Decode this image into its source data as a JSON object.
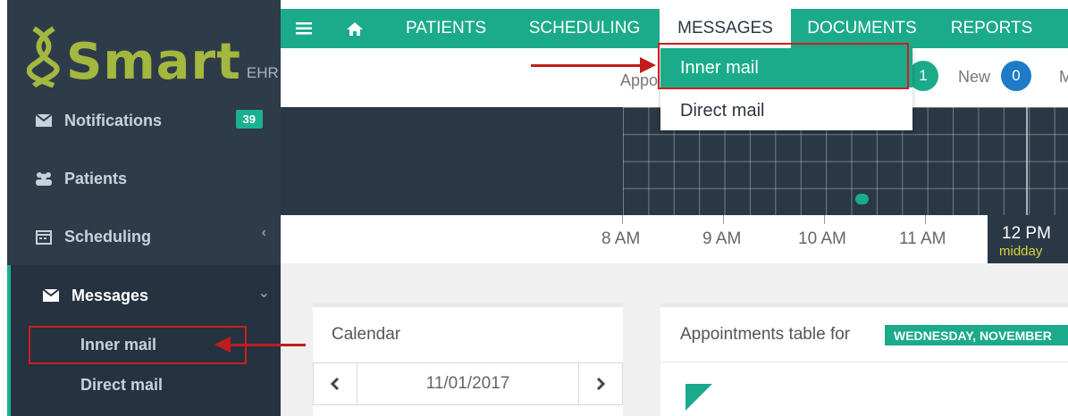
{
  "logo": {
    "name": "Smart",
    "suffix": "EHR"
  },
  "sidebar": {
    "notifications": {
      "label": "Notifications",
      "count": "39"
    },
    "patients": {
      "label": "Patients"
    },
    "scheduling": {
      "label": "Scheduling"
    },
    "messages": {
      "label": "Messages"
    },
    "sub_items": [
      "Inner mail",
      "Direct mail"
    ]
  },
  "topnav": {
    "items": [
      "PATIENTS",
      "SCHEDULING",
      "MESSAGES",
      "DOCUMENTS",
      "REPORTS"
    ],
    "active": "MESSAGES"
  },
  "dropdown": {
    "items": [
      "Inner mail",
      "Direct mail"
    ],
    "selected": "Inner mail"
  },
  "subbar": {
    "appointments_label": "Appo",
    "count_1": "1",
    "new_label": "New",
    "new_count": "0",
    "more_label": "M"
  },
  "timeline": {
    "ticks": [
      "8 AM",
      "9 AM",
      "10 AM",
      "11 AM"
    ],
    "noon": {
      "time": "12 PM",
      "sub": "midday"
    }
  },
  "calendar": {
    "title": "Calendar",
    "date": "11/01/2017"
  },
  "appointments": {
    "title": "Appointments table for",
    "day": "WEDNESDAY, NOVEMBER"
  },
  "colors": {
    "accent": "#1bab8a",
    "sidebar": "#2e3c4a",
    "highlight": "#cc1f1f",
    "blue": "#1e7bc6"
  }
}
